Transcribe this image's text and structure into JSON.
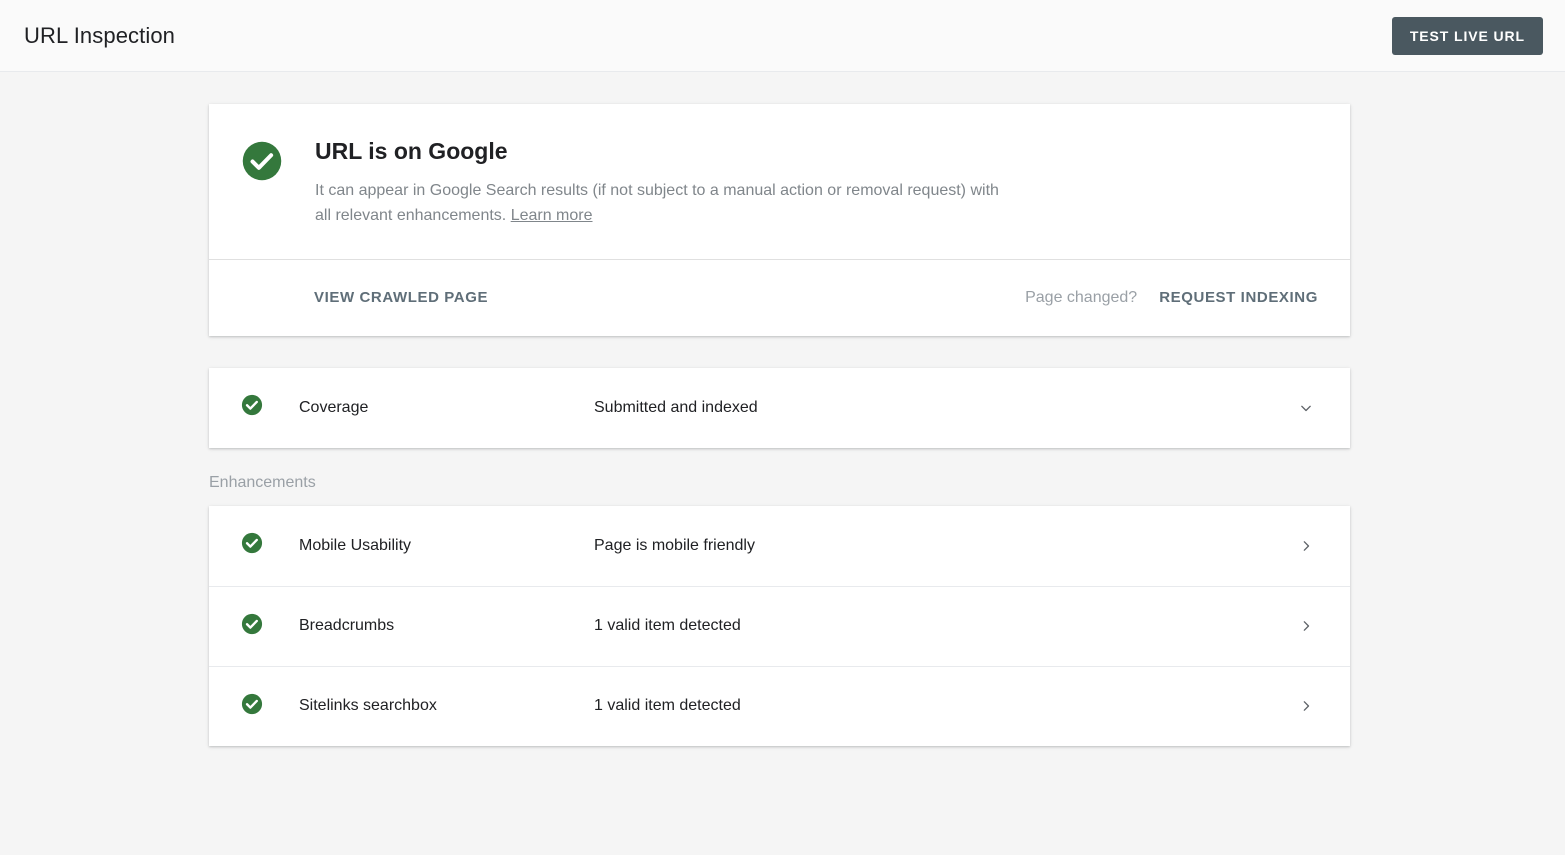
{
  "header": {
    "title": "URL Inspection",
    "test_live_url_label": "TEST LIVE URL"
  },
  "status_card": {
    "icon": "check-circle-icon",
    "title": "URL is on Google",
    "description": "It can appear in Google Search results (if not subject to a manual action or removal request) with all relevant enhancements.",
    "learn_more_label": "Learn more",
    "view_crawled_page_label": "VIEW CRAWLED PAGE",
    "page_changed_label": "Page changed?",
    "request_indexing_label": "REQUEST INDEXING"
  },
  "coverage": {
    "icon": "check-circle-icon",
    "label": "Coverage",
    "value": "Submitted and indexed",
    "expand_icon": "chevron-down-icon"
  },
  "enhancements": {
    "section_label": "Enhancements",
    "items": [
      {
        "icon": "check-circle-icon",
        "label": "Mobile Usability",
        "value": "Page is mobile friendly",
        "chevron": "chevron-right-icon"
      },
      {
        "icon": "check-circle-icon",
        "label": "Breadcrumbs",
        "value": "1 valid item detected",
        "chevron": "chevron-right-icon"
      },
      {
        "icon": "check-circle-icon",
        "label": "Sitelinks searchbox",
        "value": "1 valid item detected",
        "chevron": "chevron-right-icon"
      }
    ]
  },
  "colors": {
    "success_green": "#34783c",
    "button_slate": "#4a5860",
    "page_background": "#f5f5f5",
    "card_background": "#ffffff",
    "action_link": "#5f6e78",
    "muted_text": "#80868b"
  }
}
